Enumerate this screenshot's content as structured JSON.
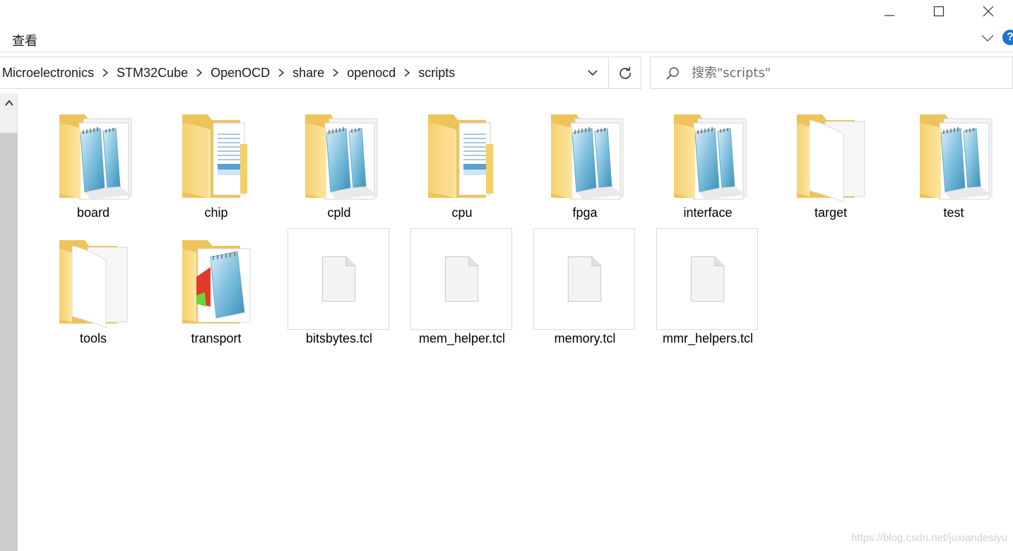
{
  "ribbon": {
    "tab_view": "查看"
  },
  "address": {
    "crumbs": [
      "Microelectronics",
      "STM32Cube",
      "OpenOCD",
      "share",
      "openocd",
      "scripts"
    ]
  },
  "search": {
    "placeholder": "搜索\"scripts\""
  },
  "items": [
    {
      "name": "board",
      "type": "folder",
      "thumb": "notepad-docs"
    },
    {
      "name": "chip",
      "type": "folder",
      "thumb": "document-pages"
    },
    {
      "name": "cpld",
      "type": "folder",
      "thumb": "notepad-docs"
    },
    {
      "name": "cpu",
      "type": "folder",
      "thumb": "document-pages"
    },
    {
      "name": "fpga",
      "type": "folder",
      "thumb": "notepad-docs"
    },
    {
      "name": "interface",
      "type": "folder",
      "thumb": "notepad-docs"
    },
    {
      "name": "target",
      "type": "folder",
      "thumb": "blank-pages"
    },
    {
      "name": "test",
      "type": "folder",
      "thumb": "notepad-docs"
    },
    {
      "name": "tools",
      "type": "folder",
      "thumb": "blank-pages"
    },
    {
      "name": "transport",
      "type": "folder",
      "thumb": "notepad-color"
    },
    {
      "name": "bitsbytes.tcl",
      "type": "file",
      "thumb": "generic-file"
    },
    {
      "name": "mem_helper.tcl",
      "type": "file",
      "thumb": "generic-file"
    },
    {
      "name": "memory.tcl",
      "type": "file",
      "thumb": "generic-file"
    },
    {
      "name": "mmr_helpers.tcl",
      "type": "file",
      "thumb": "generic-file"
    }
  ],
  "watermark": "https://blog.csdn.net/juxiandesiyu",
  "colors": {
    "folder_back": "#f6d77a",
    "folder_front": "#fbe39a",
    "accent": "#1b74d3"
  }
}
